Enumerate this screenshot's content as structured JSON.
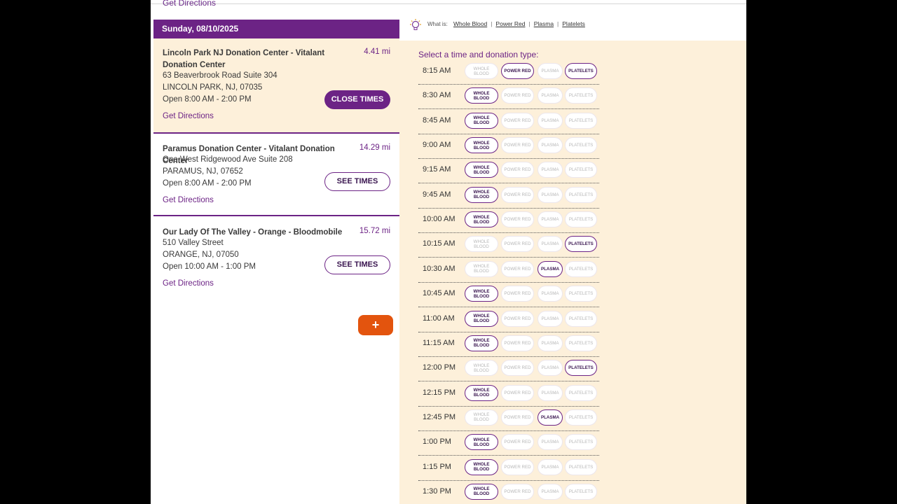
{
  "top_link": "Get Directions",
  "date_header": "Sunday, 08/10/2025",
  "locations": [
    {
      "name": "Lincoln Park NJ Donation Center - Vitalant Donation Center",
      "distance": "4.41 mi",
      "address1": "63 Beaverbrook Road Suite 304",
      "address2": "LINCOLN PARK, NJ, 07035",
      "hours": "Open 8:00 AM - 2:00 PM",
      "directions": "Get Directions",
      "button": "CLOSE TIMES"
    },
    {
      "name": "Paramus Donation Center - Vitalant Donation Center",
      "distance": "14.29 mi",
      "address1": "One West Ridgewood Ave Suite 208",
      "address2": "PARAMUS, NJ, 07652",
      "hours": "Open 8:00 AM - 2:00 PM",
      "directions": "Get Directions",
      "button": "SEE TIMES"
    },
    {
      "name": "Our Lady Of The Valley - Orange - Bloodmobile",
      "distance": "15.72 mi",
      "address1": "510 Valley Street",
      "address2": "ORANGE, NJ, 07050",
      "hours": "Open 10:00 AM - 1:00 PM",
      "directions": "Get Directions",
      "button": "SEE TIMES"
    }
  ],
  "plus_button": "+",
  "whatis": {
    "label": "What is:",
    "links": [
      "Whole Blood",
      "Power Red",
      "Plasma",
      "Platelets"
    ]
  },
  "select_title": "Select a time and donation type:",
  "pill_labels": {
    "whole_blood": "WHOLE BLOOD",
    "power_red": "POWER RED",
    "plasma": "PLASMA",
    "platelets": "PLATELETS"
  },
  "slots": [
    {
      "time": "8:15 AM",
      "whole_blood": false,
      "power_red": true,
      "plasma": false,
      "platelets": true
    },
    {
      "time": "8:30 AM",
      "whole_blood": true,
      "power_red": false,
      "plasma": false,
      "platelets": false
    },
    {
      "time": "8:45 AM",
      "whole_blood": true,
      "power_red": false,
      "plasma": false,
      "platelets": false
    },
    {
      "time": "9:00 AM",
      "whole_blood": true,
      "power_red": false,
      "plasma": false,
      "platelets": false
    },
    {
      "time": "9:15 AM",
      "whole_blood": true,
      "power_red": false,
      "plasma": false,
      "platelets": false
    },
    {
      "time": "9:45 AM",
      "whole_blood": true,
      "power_red": false,
      "plasma": false,
      "platelets": false
    },
    {
      "time": "10:00 AM",
      "whole_blood": true,
      "power_red": false,
      "plasma": false,
      "platelets": false
    },
    {
      "time": "10:15 AM",
      "whole_blood": false,
      "power_red": false,
      "plasma": false,
      "platelets": true
    },
    {
      "time": "10:30 AM",
      "whole_blood": false,
      "power_red": false,
      "plasma": true,
      "platelets": false
    },
    {
      "time": "10:45 AM",
      "whole_blood": true,
      "power_red": false,
      "plasma": false,
      "platelets": false
    },
    {
      "time": "11:00 AM",
      "whole_blood": true,
      "power_red": false,
      "plasma": false,
      "platelets": false
    },
    {
      "time": "11:15 AM",
      "whole_blood": true,
      "power_red": false,
      "plasma": false,
      "platelets": false
    },
    {
      "time": "12:00 PM",
      "whole_blood": false,
      "power_red": false,
      "plasma": false,
      "platelets": true
    },
    {
      "time": "12:15 PM",
      "whole_blood": true,
      "power_red": false,
      "plasma": false,
      "platelets": false
    },
    {
      "time": "12:45 PM",
      "whole_blood": false,
      "power_red": false,
      "plasma": true,
      "platelets": false
    },
    {
      "time": "1:00 PM",
      "whole_blood": true,
      "power_red": false,
      "plasma": false,
      "platelets": false
    },
    {
      "time": "1:15 PM",
      "whole_blood": true,
      "power_red": false,
      "plasma": false,
      "platelets": false
    },
    {
      "time": "1:30 PM",
      "whole_blood": true,
      "power_red": false,
      "plasma": false,
      "platelets": false
    }
  ],
  "colors": {
    "brand_purple": "#6c2385",
    "accent_orange": "#e3540e",
    "panel_cream": "#fdf0da"
  },
  "icons": {
    "bulb": "lightbulb-icon",
    "plus": "plus-icon"
  }
}
